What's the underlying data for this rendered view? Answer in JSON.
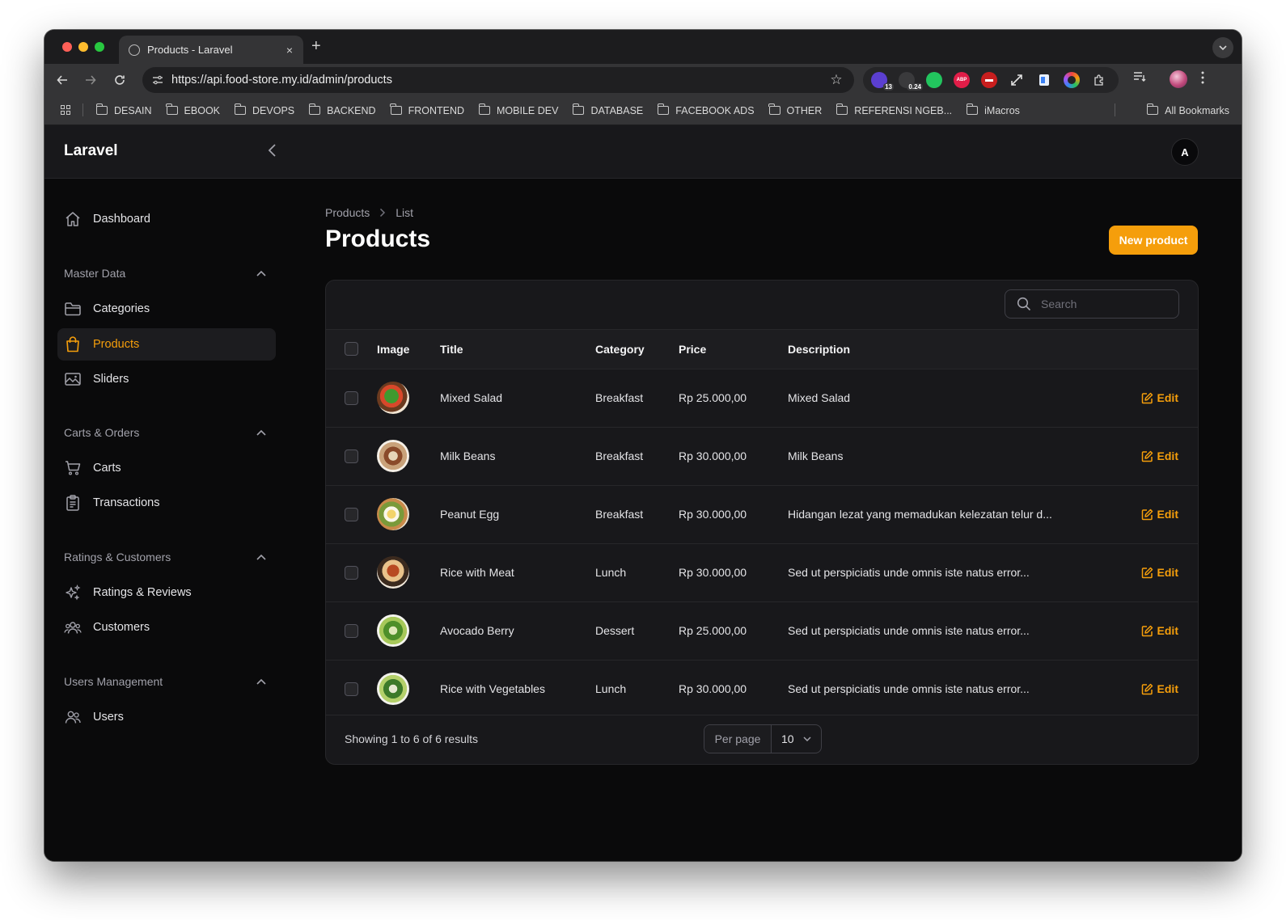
{
  "browser": {
    "tab_title": "Products - Laravel",
    "tab_close": "×",
    "new_tab": "+",
    "url": "https://api.food-store.my.id/admin/products",
    "extension_badges": {
      "first": "13",
      "second": "0.24",
      "abp": "ABP"
    },
    "bookmarks": [
      "DESAIN",
      "EBOOK",
      "DEVOPS",
      "BACKEND",
      "FRONTEND",
      "MOBILE DEV",
      "DATABASE",
      "FACEBOOK ADS",
      "OTHER",
      "REFERENSI NGEB...",
      "iMacros"
    ],
    "all_bookmarks": "All Bookmarks"
  },
  "app": {
    "brand": "Laravel",
    "avatar_initial": "A",
    "accent_color": "#f59e0b"
  },
  "sidebar": {
    "dashboard": "Dashboard",
    "groups": {
      "master_data": "Master Data",
      "carts_orders": "Carts & Orders",
      "ratings_customers": "Ratings & Customers",
      "users_management": "Users Management"
    },
    "items": {
      "categories": "Categories",
      "products": "Products",
      "sliders": "Sliders",
      "carts": "Carts",
      "transactions": "Transactions",
      "ratings_reviews": "Ratings & Reviews",
      "customers": "Customers",
      "users": "Users"
    },
    "active": "products"
  },
  "page": {
    "breadcrumb": [
      "Products",
      "List"
    ],
    "title": "Products",
    "new_button": "New product"
  },
  "table": {
    "search_placeholder": "Search",
    "columns": {
      "image": "Image",
      "title": "Title",
      "category": "Category",
      "price": "Price",
      "description": "Description"
    },
    "edit_label": "Edit",
    "rows": [
      {
        "title": "Mixed Salad",
        "category": "Breakfast",
        "price": "Rp 25.000,00",
        "description": "Mixed Salad"
      },
      {
        "title": "Milk Beans",
        "category": "Breakfast",
        "price": "Rp 30.000,00",
        "description": "Milk Beans"
      },
      {
        "title": "Peanut Egg",
        "category": "Breakfast",
        "price": "Rp 30.000,00",
        "description": "Hidangan lezat yang memadukan kelezatan telur d..."
      },
      {
        "title": "Rice with Meat",
        "category": "Lunch",
        "price": "Rp 30.000,00",
        "description": "Sed ut perspiciatis unde omnis iste natus error..."
      },
      {
        "title": "Avocado Berry",
        "category": "Dessert",
        "price": "Rp 25.000,00",
        "description": "Sed ut perspiciatis unde omnis iste natus error..."
      },
      {
        "title": "Rice with Vegetables",
        "category": "Lunch",
        "price": "Rp 30.000,00",
        "description": "Sed ut perspiciatis unde omnis iste natus error..."
      }
    ],
    "footer": {
      "showing": "Showing 1 to 6 of 6 results",
      "per_page_label": "Per page",
      "per_page_value": "10"
    }
  }
}
